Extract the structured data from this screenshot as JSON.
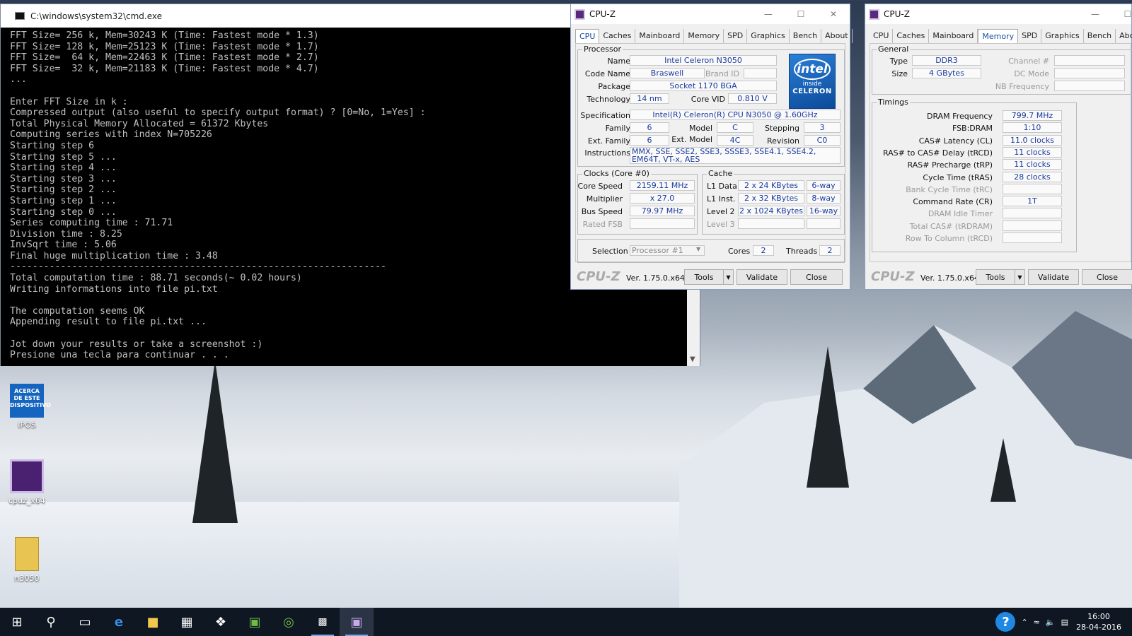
{
  "cmd": {
    "title": "C:\\windows\\system32\\cmd.exe",
    "lines": [
      "FFT Size= 256 k, Mem=30243 K (Time: Fastest mode * 1.3)",
      "FFT Size= 128 k, Mem=25123 K (Time: Fastest mode * 1.7)",
      "FFT Size=  64 k, Mem=22463 K (Time: Fastest mode * 2.7)",
      "FFT Size=  32 k, Mem=21183 K (Time: Fastest mode * 4.7)",
      "...",
      "",
      "Enter FFT Size in k :",
      "Compressed output (also useful to specify output format) ? [0=No, 1=Yes] :",
      "Total Physical Memory Allocated = 61372 Kbytes",
      "Computing series with index N=705226",
      "Starting step 6",
      "Starting step 5 ...",
      "Starting step 4 ...",
      "Starting step 3 ...",
      "Starting step 2 ...",
      "Starting step 1 ...",
      "Starting step 0 ...",
      "Series computing time : 71.71",
      "Division time : 8.25",
      "InvSqrt time : 5.06",
      "Final huge multiplication time : 3.48",
      "-------------------------------------------------------------------",
      "Total computation time : 88.71 seconds(~ 0.02 hours)",
      "Writing informations into file pi.txt",
      "",
      "The computation seems OK",
      "Appending result to file pi.txt ...",
      "",
      "Jot down your results or take a screenshot :)",
      "Presione una tecla para continuar . . ."
    ]
  },
  "cpuz_cpu": {
    "title": "CPU-Z",
    "tabs": [
      "CPU",
      "Caches",
      "Mainboard",
      "Memory",
      "SPD",
      "Graphics",
      "Bench",
      "About"
    ],
    "active_tab": "CPU",
    "processor_group": "Processor",
    "labels": {
      "name": "Name",
      "code_name": "Code Name",
      "brand_id": "Brand ID",
      "package": "Package",
      "technology": "Technology",
      "core_vid": "Core VID",
      "specification": "Specification",
      "family": "Family",
      "model": "Model",
      "stepping": "Stepping",
      "ext_family": "Ext. Family",
      "ext_model": "Ext. Model",
      "revision": "Revision",
      "instructions": "Instructions"
    },
    "values": {
      "name": "Intel Celeron N3050",
      "code_name": "Braswell",
      "package": "Socket 1170 BGA",
      "technology": "14 nm",
      "core_vid": "0.810 V",
      "specification": "Intel(R) Celeron(R) CPU  N3050  @ 1.60GHz",
      "family": "6",
      "model": "C",
      "stepping": "3",
      "ext_family": "6",
      "ext_model": "4C",
      "revision": "C0",
      "instructions": "MMX, SSE, SSE2, SSE3, SSSE3, SSE4.1, SSE4.2, EM64T, VT-x, AES"
    },
    "logo": {
      "intel": "intel",
      "inside": "inside",
      "brand": "CELERON"
    },
    "clocks_group": "Clocks (Core #0)",
    "clocks": {
      "core_speed_label": "Core Speed",
      "core_speed": "2159.11 MHz",
      "multiplier_label": "Multiplier",
      "multiplier": "x 27.0",
      "bus_speed_label": "Bus Speed",
      "bus_speed": "79.97 MHz",
      "rated_fsb_label": "Rated FSB"
    },
    "cache_group": "Cache",
    "cache": {
      "l1d_label": "L1 Data",
      "l1d": "2 x 24 KBytes",
      "l1d_way": "6-way",
      "l1i_label": "L1 Inst.",
      "l1i": "2 x 32 KBytes",
      "l1i_way": "8-way",
      "l2_label": "Level 2",
      "l2": "2 x 1024 KBytes",
      "l2_way": "16-way",
      "l3_label": "Level 3"
    },
    "selection_label": "Selection",
    "selection": "Processor #1",
    "cores_label": "Cores",
    "cores": "2",
    "threads_label": "Threads",
    "threads": "2",
    "footer": {
      "logo": "CPU-Z",
      "version": "Ver. 1.75.0.x64",
      "tools": "Tools",
      "validate": "Validate",
      "close": "Close"
    }
  },
  "cpuz_mem": {
    "title": "CPU-Z",
    "tabs": [
      "CPU",
      "Caches",
      "Mainboard",
      "Memory",
      "SPD",
      "Graphics",
      "Bench",
      "About"
    ],
    "active_tab": "Memory",
    "general_group": "General",
    "general": {
      "type_label": "Type",
      "type": "DDR3",
      "size_label": "Size",
      "size": "4 GBytes",
      "channel_label": "Channel #",
      "dc_mode_label": "DC Mode",
      "nb_freq_label": "NB Frequency"
    },
    "timings_group": "Timings",
    "timings": [
      {
        "label": "DRAM Frequency",
        "value": "799.7 MHz",
        "dim": false
      },
      {
        "label": "FSB:DRAM",
        "value": "1:10",
        "dim": false
      },
      {
        "label": "CAS# Latency (CL)",
        "value": "11.0 clocks",
        "dim": false
      },
      {
        "label": "RAS# to CAS# Delay (tRCD)",
        "value": "11 clocks",
        "dim": false
      },
      {
        "label": "RAS# Precharge (tRP)",
        "value": "11 clocks",
        "dim": false
      },
      {
        "label": "Cycle Time (tRAS)",
        "value": "28 clocks",
        "dim": false
      },
      {
        "label": "Bank Cycle Time (tRC)",
        "value": "",
        "dim": true
      },
      {
        "label": "Command Rate (CR)",
        "value": "1T",
        "dim": false
      },
      {
        "label": "DRAM Idle Timer",
        "value": "",
        "dim": true
      },
      {
        "label": "Total CAS# (tRDRAM)",
        "value": "",
        "dim": true
      },
      {
        "label": "Row To Column (tRCD)",
        "value": "",
        "dim": true
      }
    ],
    "footer": {
      "logo": "CPU-Z",
      "version": "Ver. 1.75.0.x64",
      "tools": "Tools",
      "validate": "Validate",
      "close": "Close"
    }
  },
  "desktop_icons": [
    {
      "label": "IPOS",
      "icon": "acerca-de-este-dispositivo-icon",
      "icon_text": "ACERCA DE ESTE DISPOSITIVO"
    },
    {
      "label": "cpuz_x64",
      "icon": "cpuz-icon"
    },
    {
      "label": "n3050",
      "icon": "folder-icon"
    }
  ],
  "taskbar": {
    "items": [
      "start-icon",
      "search-icon",
      "task-view-icon",
      "edge-icon",
      "file-explorer-icon",
      "store-icon",
      "dropbox-icon",
      "notepad-icon",
      "tripadvisor-icon",
      "cmd-icon",
      "cpuz-icon"
    ],
    "clock_time": "16:00",
    "clock_date": "28-04-2016"
  },
  "colors": {
    "accent": "#1a4fa0",
    "taskbar": "#0f1722",
    "value_text": "#1a3aa0"
  }
}
